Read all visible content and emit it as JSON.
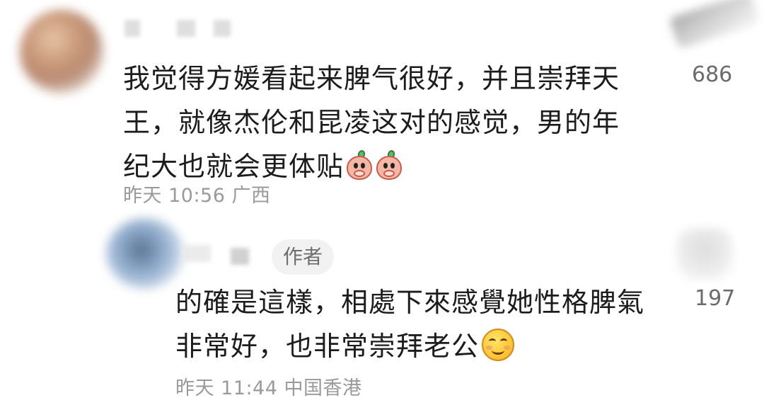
{
  "comments": [
    {
      "text": "我觉得方媛看起来脾气很好，并且崇拜天王，就像杰伦和昆凌这对的感觉，男的年纪大也就会更体贴",
      "emoji": [
        "peach-face-emoji",
        "peach-face-emoji"
      ],
      "meta": "昨天 10:56 广西",
      "likes": "686"
    },
    {
      "author_tag": "作者",
      "text": "的確是這樣，相處下來感覺她性格脾氣非常好，也非常崇拜老公",
      "emoji": [
        "smiling-face-emoji"
      ],
      "meta": "昨天 11:44 中国香港",
      "likes": "197"
    }
  ]
}
